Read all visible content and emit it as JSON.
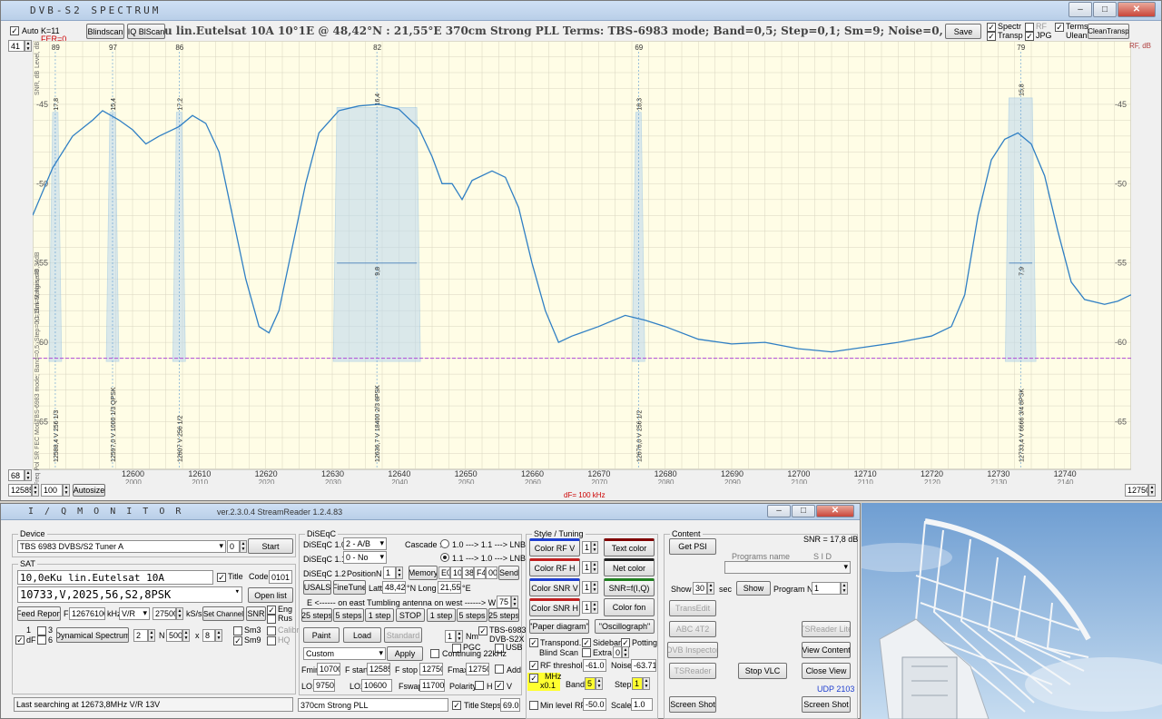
{
  "spectrum": {
    "title": "DVB-S2   SPECTRUM",
    "auto_label": "Auto",
    "k_label": "K=11",
    "fer_label": "FER=0",
    "blindscan": "Blindscan",
    "iq_blscan": "IQ BlScan",
    "info_line": "u lin.Eutelsat 10A      10°1E  @  48,42°N : 21,55°E      370cm Strong PLL      Terms:  TBS-6983 mode; Band=0,5; Step=0,1; Sm=9; Noise=0,34dB      Locked  9 V",
    "save": "Save",
    "opts": [
      "Spectr",
      "RF",
      "Terms",
      "Transp",
      "JPG",
      "Ulean"
    ],
    "clean": "CleanTransp",
    "level_top": "41",
    "level_bottom": "68",
    "fstart": "12585",
    "fend": "12750",
    "step": "100",
    "autosize": "Autosize",
    "df_label": "dF= 100 kHz",
    "left_axis_labels": [
      "Level, dB",
      "SNR, dB",
      "Link Margin, dB",
      "K=11",
      "TBS-6983 mode; Band=0,5; Step=0,1; Sm=9; Noise=0,34dB",
      "Freq  Pol  SR  FEC  Mod"
    ],
    "right_axis": "RF, dB",
    "colors": {
      "plot_bg": "#fffde6",
      "grid": "#d8d5c0",
      "curve": "#2f7fc4",
      "fill": "#bcd8ee",
      "threshold": "#b04ad8"
    }
  },
  "chart_data": {
    "type": "line",
    "x_range": [
      12585,
      12750
    ],
    "ylim": [
      -68,
      -41
    ],
    "x_ticks": [
      12600,
      12610,
      12620,
      12630,
      12640,
      12650,
      12660,
      12670,
      12680,
      12690,
      12700,
      12710,
      12720,
      12730,
      12740
    ],
    "x_subticks": [
      2000,
      2010,
      2020,
      2030,
      2040,
      2050,
      2060,
      2070,
      2080,
      2090,
      2100,
      2110,
      2120,
      2130,
      2140
    ],
    "y_ticks": [
      -45,
      -50,
      -55,
      -60,
      -65
    ],
    "threshold": -61,
    "series": [
      {
        "values": [
          [
            12585,
            -52
          ],
          [
            12588,
            -49
          ],
          [
            12591,
            -47
          ],
          [
            12594,
            -46
          ],
          [
            12595.5,
            -45.4
          ],
          [
            12598,
            -46
          ],
          [
            12600,
            -46.6
          ],
          [
            12602,
            -47.5
          ],
          [
            12604,
            -47
          ],
          [
            12607,
            -46.4
          ],
          [
            12609,
            -45.7
          ],
          [
            12611,
            -46.2
          ],
          [
            12613,
            -48
          ],
          [
            12615,
            -52
          ],
          [
            12617,
            -56
          ],
          [
            12619,
            -59
          ],
          [
            12620.5,
            -59.4
          ],
          [
            12622,
            -58
          ],
          [
            12624,
            -54
          ],
          [
            12626,
            -50
          ],
          [
            12628,
            -46.8
          ],
          [
            12631,
            -45.4
          ],
          [
            12634,
            -45.1
          ],
          [
            12637,
            -45
          ],
          [
            12640,
            -45.3
          ],
          [
            12643,
            -46.5
          ],
          [
            12645,
            -48.3
          ],
          [
            12646.5,
            -50
          ],
          [
            12648,
            -50
          ],
          [
            12649.5,
            -51
          ],
          [
            12651,
            -49.8
          ],
          [
            12654,
            -49.2
          ],
          [
            12656,
            -49.6
          ],
          [
            12658,
            -51.5
          ],
          [
            12660,
            -55
          ],
          [
            12662,
            -58
          ],
          [
            12664,
            -60
          ],
          [
            12666,
            -59.6
          ],
          [
            12670,
            -59
          ],
          [
            12674,
            -58.3
          ],
          [
            12677,
            -58.6
          ],
          [
            12680,
            -59
          ],
          [
            12685,
            -59.8
          ],
          [
            12690,
            -60.1
          ],
          [
            12695,
            -60
          ],
          [
            12700,
            -60.4
          ],
          [
            12705,
            -60.6
          ],
          [
            12710,
            -60.3
          ],
          [
            12715,
            -60
          ],
          [
            12720,
            -59.6
          ],
          [
            12723,
            -59
          ],
          [
            12725,
            -57
          ],
          [
            12727,
            -52
          ],
          [
            12729,
            -48.5
          ],
          [
            12731,
            -47.2
          ],
          [
            12733,
            -46.8
          ],
          [
            12735,
            -47.5
          ],
          [
            12737,
            -49.5
          ],
          [
            12739,
            -53
          ],
          [
            12741,
            -56.2
          ],
          [
            12743,
            -57.3
          ],
          [
            12746,
            -57.6
          ],
          [
            12748,
            -57.4
          ],
          [
            12750,
            -57
          ]
        ]
      }
    ],
    "transponders": [
      {
        "freq": 12588.4,
        "label": "12588,4  V  256  1/3",
        "snr": "17,8",
        "marker": "89"
      },
      {
        "freq": 12597.0,
        "label": "12597,0  V  1000  1/3  QPSK",
        "snr": "15,4",
        "marker": "97"
      },
      {
        "freq": 12607.0,
        "label": "12607  V  256  1/2",
        "snr": "17,2",
        "marker": "86"
      },
      {
        "freq": 12636.7,
        "label": "12636,7  V  18400  2/3  8PSK",
        "snr": "16,4",
        "marker": "82",
        "snr2": "9,8"
      },
      {
        "freq": 12676.0,
        "label": "12676,0  V  256  1/2",
        "snr": "18,3",
        "marker": "69"
      },
      {
        "freq": 12733.4,
        "label": "12733,4  V  6666  3/4  8PSK",
        "snr": "15,8",
        "marker": "79",
        "snr2": "7,9"
      }
    ]
  },
  "iq": {
    "title": "I / Q   M O N I T O R",
    "version": "ver.2.3.0.4  StreamReader 1.2.4.83",
    "device_group": "Device",
    "device": "TBS 6983 DVBS/S2 Tuner A",
    "device_idx": "0",
    "start": "Start",
    "sat_group": "SAT",
    "sat_name": "10,0eKu lin.Eutelsat 10A",
    "title_chk": "Title",
    "code_label": "Code",
    "code": "0101",
    "tp_line": "10733,V,2025,56,S2,8PSK",
    "open_list": "Open list",
    "feed_report": "Feed Report",
    "f_label": "F",
    "f_value": "12676100",
    "khz": "kHz",
    "pol": "V/R",
    "sr": "27500",
    "ksps": "kS/s",
    "set_channel": "Set Channel",
    "snr": "SNR",
    "eng": "Eng",
    "rus": "Rus",
    "cb1": "1",
    "cb3": "3",
    "cb6": "6",
    "df": "dF",
    "dyn_spectrum": "Dynamical Spectrum",
    "dyn_n1": "2",
    "n_label": "N",
    "dyn_n2": "500",
    "x_label": "x",
    "dyn_n3": "8",
    "sm3": "Sm3",
    "sm9": "Sm9",
    "calibr": "Calibr",
    "hq": "HQ",
    "status": "Last searching at 12673,8MHz  V/R  13V",
    "diseqc_group": "DiSEqC",
    "d10": "DiSEqC 1.0",
    "d10v": "2 - A/B",
    "d11": "DiSEqC 1.1",
    "d11v": "0 - No",
    "cascade": "Cascade :",
    "casc1": "1.0 ---> 1.1 ---> LNB",
    "casc2": "1.1 ---> 1.0 ---> LNB",
    "d12": "DiSEqC 1.2",
    "position": "Position",
    "n": "N",
    "pos_n": "1",
    "memory": "Memory",
    "mem_code": [
      "E0",
      "10",
      "38",
      "F4",
      "00"
    ],
    "send": "Send",
    "usals": "USALS",
    "finetune": "FineTune",
    "latt": "Latt",
    "latt_v": "48,42",
    "n_long": "°N  Long",
    "long_v": "21,55",
    "e_deg": "°E",
    "east_line": "E  <------  on  east    Tumbling antenna    on  west  ------>  W",
    "w_val": "75",
    "steps_e": [
      "25 steps",
      "5 steps",
      "1 step"
    ],
    "stop": "STOP",
    "steps_w": [
      "1 step",
      "5 steps",
      "25 steps"
    ],
    "paint": "Paint",
    "load": "Load",
    "standard": "Standard",
    "nm_val": "1",
    "nm": "Nm",
    "tbs": "TBS-6983",
    "dvbs2x": "DVB-S2X",
    "pgc": "PGC",
    "usb": "USB",
    "custom": "Custom",
    "apply": "Apply",
    "continuing": "Continuing 22kHz",
    "fmin": "Fmin",
    "fmin_v": "10700",
    "fstart": "F start",
    "fstart_v": "12585",
    "fstop": "F stop",
    "fstop_v": "12750",
    "fmax": "Fmax",
    "fmax_v": "12750",
    "add": "Add",
    "lo1": "LO1",
    "lo1_v": "9750",
    "lo2": "LO2",
    "lo2_v": "10600",
    "fswap": "Fswap",
    "fswap_v": "11700",
    "polarity": "Polarity",
    "h": "H",
    "v": "V",
    "lnb_name": "370cm Strong PLL",
    "title2": "Title",
    "steps": "Steps",
    "steps_v": "69.0",
    "style_group": "Style / Tuning",
    "color_rf_v": "Color  RF V",
    "color_rf_h": "Color  RF H",
    "color_snr_v": "Color  SNR V",
    "color_snr_h": "Color  SNR H",
    "one": "1",
    "text_color": "Text color",
    "net_color": "Net color",
    "snr_fiq": "SNR=f(I,Q)",
    "color_fon": "Color fon",
    "paper": "\"Paper diagram\"",
    "oscillo": "\"Oscillograph\"",
    "transpond": "Transpond.",
    "sidebar": "Sidebar",
    "potting": "Potting",
    "blind_scan": "Blind  Scan",
    "extra": "Extra",
    "zero": "0",
    "rf_threshold": "RF threshold",
    "rf_thr_v": "-61.0",
    "noise": "Noise",
    "noise_v": "-63.71",
    "mhz": "MHz",
    "x01": "x0.1",
    "band": "Band",
    "band_v": "5",
    "step": "Step",
    "step_v": "1",
    "min_rf": "Min level RF",
    "min_rf_v": "-50.0",
    "scale": "Scale",
    "scale_v": "1.0",
    "content_group": "Content",
    "snr_val": "SNR = 17,8 dB",
    "get_psi": "Get  PSI",
    "programs_name": "Programs  name",
    "sid": "S I D",
    "show": "Show",
    "show_v": "30",
    "sec": "sec",
    "show_btn": "Show",
    "program_n": "Program  N",
    "program_v": "1",
    "transedit": "TransEdit",
    "tsreader_lite": "TSReader Lite",
    "abc": "ABC 4T2",
    "view_content": "View Content",
    "dvb_insp": "DVB Inspector",
    "tsreader": "TSReader",
    "stop_vlc": "Stop  VLC",
    "close_view": "Close View",
    "udp": "UDP 2103",
    "screen_shot1": "Screen Shot",
    "screen_shot2": "Screen Shot"
  }
}
